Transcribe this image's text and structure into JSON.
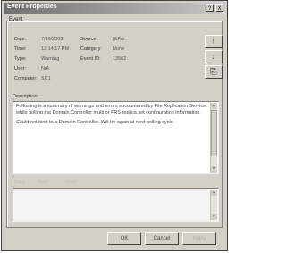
{
  "window": {
    "title": "Event Properties",
    "help_glyph": "?",
    "close_glyph": "X"
  },
  "tab": {
    "label": "Event"
  },
  "fields": {
    "date_label": "Date:",
    "date_value": "7/16/2003",
    "source_label": "Source:",
    "source_value": "NtFrs",
    "time_label": "Time:",
    "time_value": "12:14:17 PM",
    "category_label": "Category:",
    "category_value": "None",
    "type_label": "Type:",
    "type_value": "Warning",
    "event_id_label": "Event ID:",
    "event_id_value": "13562",
    "user_label": "User:",
    "user_value": "N/A",
    "computer_label": "Computer:",
    "computer_value": "SC1"
  },
  "nav": {
    "up_glyph": "↑",
    "down_glyph": "↓",
    "copy_glyph": "⎘"
  },
  "description": {
    "label": "Description:",
    "paragraph1": "Following is a summary of warnings and errors encountered by File Replication Service while polling the Domain Controller multi or FRS replica set configuration information.",
    "paragraph2": "Could not bind to a Domain Controller. Will try again at next polling cycle."
  },
  "data": {
    "label": "Data:",
    "bytes_label": "Bytes",
    "words_label": "Words"
  },
  "footer": {
    "ok_label": "OK",
    "cancel_label": "Cancel",
    "apply_label": "Apply"
  }
}
